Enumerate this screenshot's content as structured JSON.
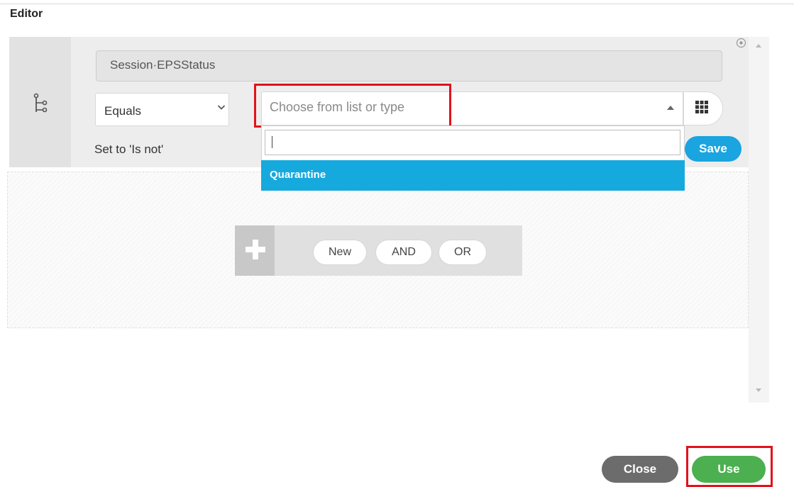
{
  "dialog": {
    "title": "Editor"
  },
  "condition": {
    "attribute": "Session·EPSStatus",
    "operator": "Equals",
    "value_placeholder": "Choose from list or type",
    "negate_hint": "Set to 'Is not'",
    "save_label": "Save",
    "dropdown": {
      "search_value": "",
      "options": [
        "Quarantine"
      ],
      "selected": "Quarantine"
    }
  },
  "builder": {
    "buttons": [
      "New",
      "AND",
      "OR"
    ]
  },
  "footer": {
    "close_label": "Close",
    "use_label": "Use"
  },
  "colors": {
    "accent_blue": "#1aa4e0",
    "option_highlight": "#16a9dd",
    "use_green": "#4caf50",
    "close_gray": "#6c6c6c",
    "annotation_red": "#e2121b"
  },
  "icons": {
    "tree": "tree-icon",
    "chevron": "chevron-down-icon",
    "caret": "caret-up-icon",
    "grid": "grid-icon",
    "plus": "plus-icon",
    "clear": "clear-circle-icon"
  }
}
